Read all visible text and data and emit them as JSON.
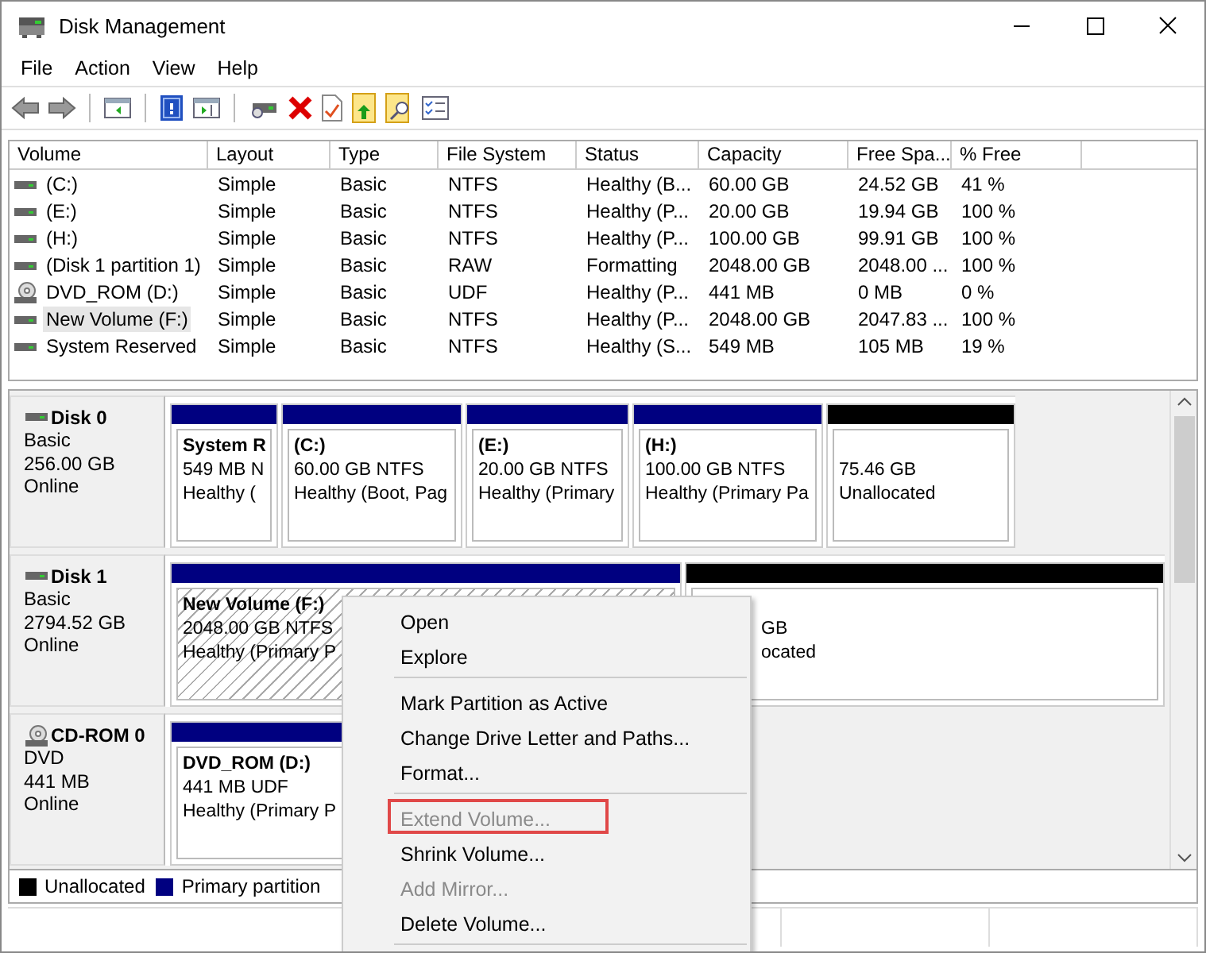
{
  "window": {
    "title": "Disk Management"
  },
  "menu_bar": [
    "File",
    "Action",
    "View",
    "Help"
  ],
  "toolbar": [
    {
      "kind": "back"
    },
    {
      "kind": "forward"
    },
    {
      "kind": "sep"
    },
    {
      "kind": "tree"
    },
    {
      "kind": "sep"
    },
    {
      "kind": "help"
    },
    {
      "kind": "pane"
    },
    {
      "kind": "sep"
    },
    {
      "kind": "connect"
    },
    {
      "kind": "delete"
    },
    {
      "kind": "check"
    },
    {
      "kind": "folder-up"
    },
    {
      "kind": "folder-search"
    },
    {
      "kind": "list"
    }
  ],
  "table": {
    "columns": [
      "Volume",
      "Layout",
      "Type",
      "File System",
      "Status",
      "Capacity",
      "Free Spa...",
      "% Free"
    ],
    "rows": [
      {
        "kind": "drive",
        "selected": false,
        "cells": [
          "(C:)",
          "Simple",
          "Basic",
          "NTFS",
          "Healthy (B...",
          "60.00 GB",
          "24.52 GB",
          "41 %"
        ]
      },
      {
        "kind": "drive",
        "selected": false,
        "cells": [
          "(E:)",
          "Simple",
          "Basic",
          "NTFS",
          "Healthy (P...",
          "20.00 GB",
          "19.94 GB",
          "100 %"
        ]
      },
      {
        "kind": "drive",
        "selected": false,
        "cells": [
          "(H:)",
          "Simple",
          "Basic",
          "NTFS",
          "Healthy (P...",
          "100.00 GB",
          "99.91 GB",
          "100 %"
        ]
      },
      {
        "kind": "drive",
        "selected": false,
        "cells": [
          "(Disk 1 partition 1)",
          "Simple",
          "Basic",
          "RAW",
          "Formatting",
          "2048.00 GB",
          "2048.00 ...",
          "100 %"
        ]
      },
      {
        "kind": "cd",
        "selected": false,
        "cells": [
          "DVD_ROM (D:)",
          "Simple",
          "Basic",
          "UDF",
          "Healthy (P...",
          "441 MB",
          "0 MB",
          "0 %"
        ]
      },
      {
        "kind": "drive",
        "selected": true,
        "cells": [
          "New Volume (F:)",
          "Simple",
          "Basic",
          "NTFS",
          "Healthy (P...",
          "2048.00 GB",
          "2047.83 ...",
          "100 %"
        ]
      },
      {
        "kind": "drive",
        "selected": false,
        "cells": [
          "System Reserved",
          "Simple",
          "Basic",
          "NTFS",
          "Healthy (S...",
          "549 MB",
          "105 MB",
          "19 %"
        ]
      }
    ]
  },
  "disks": [
    {
      "kind": "drive",
      "name": "Disk 0",
      "lines": [
        "Basic",
        "256.00 GB",
        "Online"
      ],
      "partitions": [
        {
          "kind": "primary",
          "selected": false,
          "title": "System R",
          "lines": [
            "549 MB N",
            "Healthy ("
          ]
        },
        {
          "kind": "primary",
          "selected": false,
          "title": "(C:)",
          "lines": [
            "60.00 GB NTFS",
            "Healthy (Boot, Pag"
          ]
        },
        {
          "kind": "primary",
          "selected": false,
          "title": "(E:)",
          "lines": [
            "20.00 GB NTFS",
            "Healthy (Primary"
          ]
        },
        {
          "kind": "primary",
          "selected": false,
          "title": "(H:)",
          "lines": [
            "100.00 GB NTFS",
            "Healthy (Primary Pa"
          ]
        },
        {
          "kind": "unallocated",
          "selected": false,
          "lines": [
            "75.46 GB",
            "Unallocated"
          ]
        }
      ]
    },
    {
      "kind": "drive",
      "name": "Disk 1",
      "lines": [
        "Basic",
        "2794.52 GB",
        "Online"
      ],
      "partitions": [
        {
          "kind": "primary",
          "selected": true,
          "title": "New Volume  (F:)",
          "lines": [
            "2048.00 GB NTFS",
            "Healthy (Primary P"
          ]
        },
        {
          "kind": "unallocated",
          "selected": false,
          "lines": [
            "GB",
            "ocated"
          ]
        }
      ]
    },
    {
      "kind": "cd",
      "name": "CD-ROM 0",
      "lines": [
        "DVD",
        "441 MB",
        "Online"
      ],
      "partitions": [
        {
          "kind": "primary",
          "selected": false,
          "title": "DVD_ROM  (D:)",
          "lines": [
            "441 MB UDF",
            "Healthy (Primary P"
          ]
        }
      ]
    }
  ],
  "legend": [
    {
      "label": "Unallocated",
      "color": "#000000"
    },
    {
      "label": "Primary partition",
      "color": "#000080"
    }
  ],
  "context_menu": [
    {
      "kind": "item",
      "label": "Open",
      "disabled": false,
      "highlighted": false
    },
    {
      "kind": "item",
      "label": "Explore",
      "disabled": false,
      "highlighted": false
    },
    {
      "kind": "separator"
    },
    {
      "kind": "item",
      "label": "Mark Partition as Active",
      "disabled": false,
      "highlighted": false
    },
    {
      "kind": "item",
      "label": "Change Drive Letter and Paths...",
      "disabled": false,
      "highlighted": false
    },
    {
      "kind": "item",
      "label": "Format...",
      "disabled": false,
      "highlighted": false
    },
    {
      "kind": "separator"
    },
    {
      "kind": "item",
      "label": "Extend Volume...",
      "disabled": true,
      "highlighted": true
    },
    {
      "kind": "item",
      "label": "Shrink Volume...",
      "disabled": false,
      "highlighted": false
    },
    {
      "kind": "item",
      "label": "Add Mirror...",
      "disabled": true,
      "highlighted": false
    },
    {
      "kind": "item",
      "label": "Delete Volume...",
      "disabled": false,
      "highlighted": false
    },
    {
      "kind": "separator"
    }
  ]
}
